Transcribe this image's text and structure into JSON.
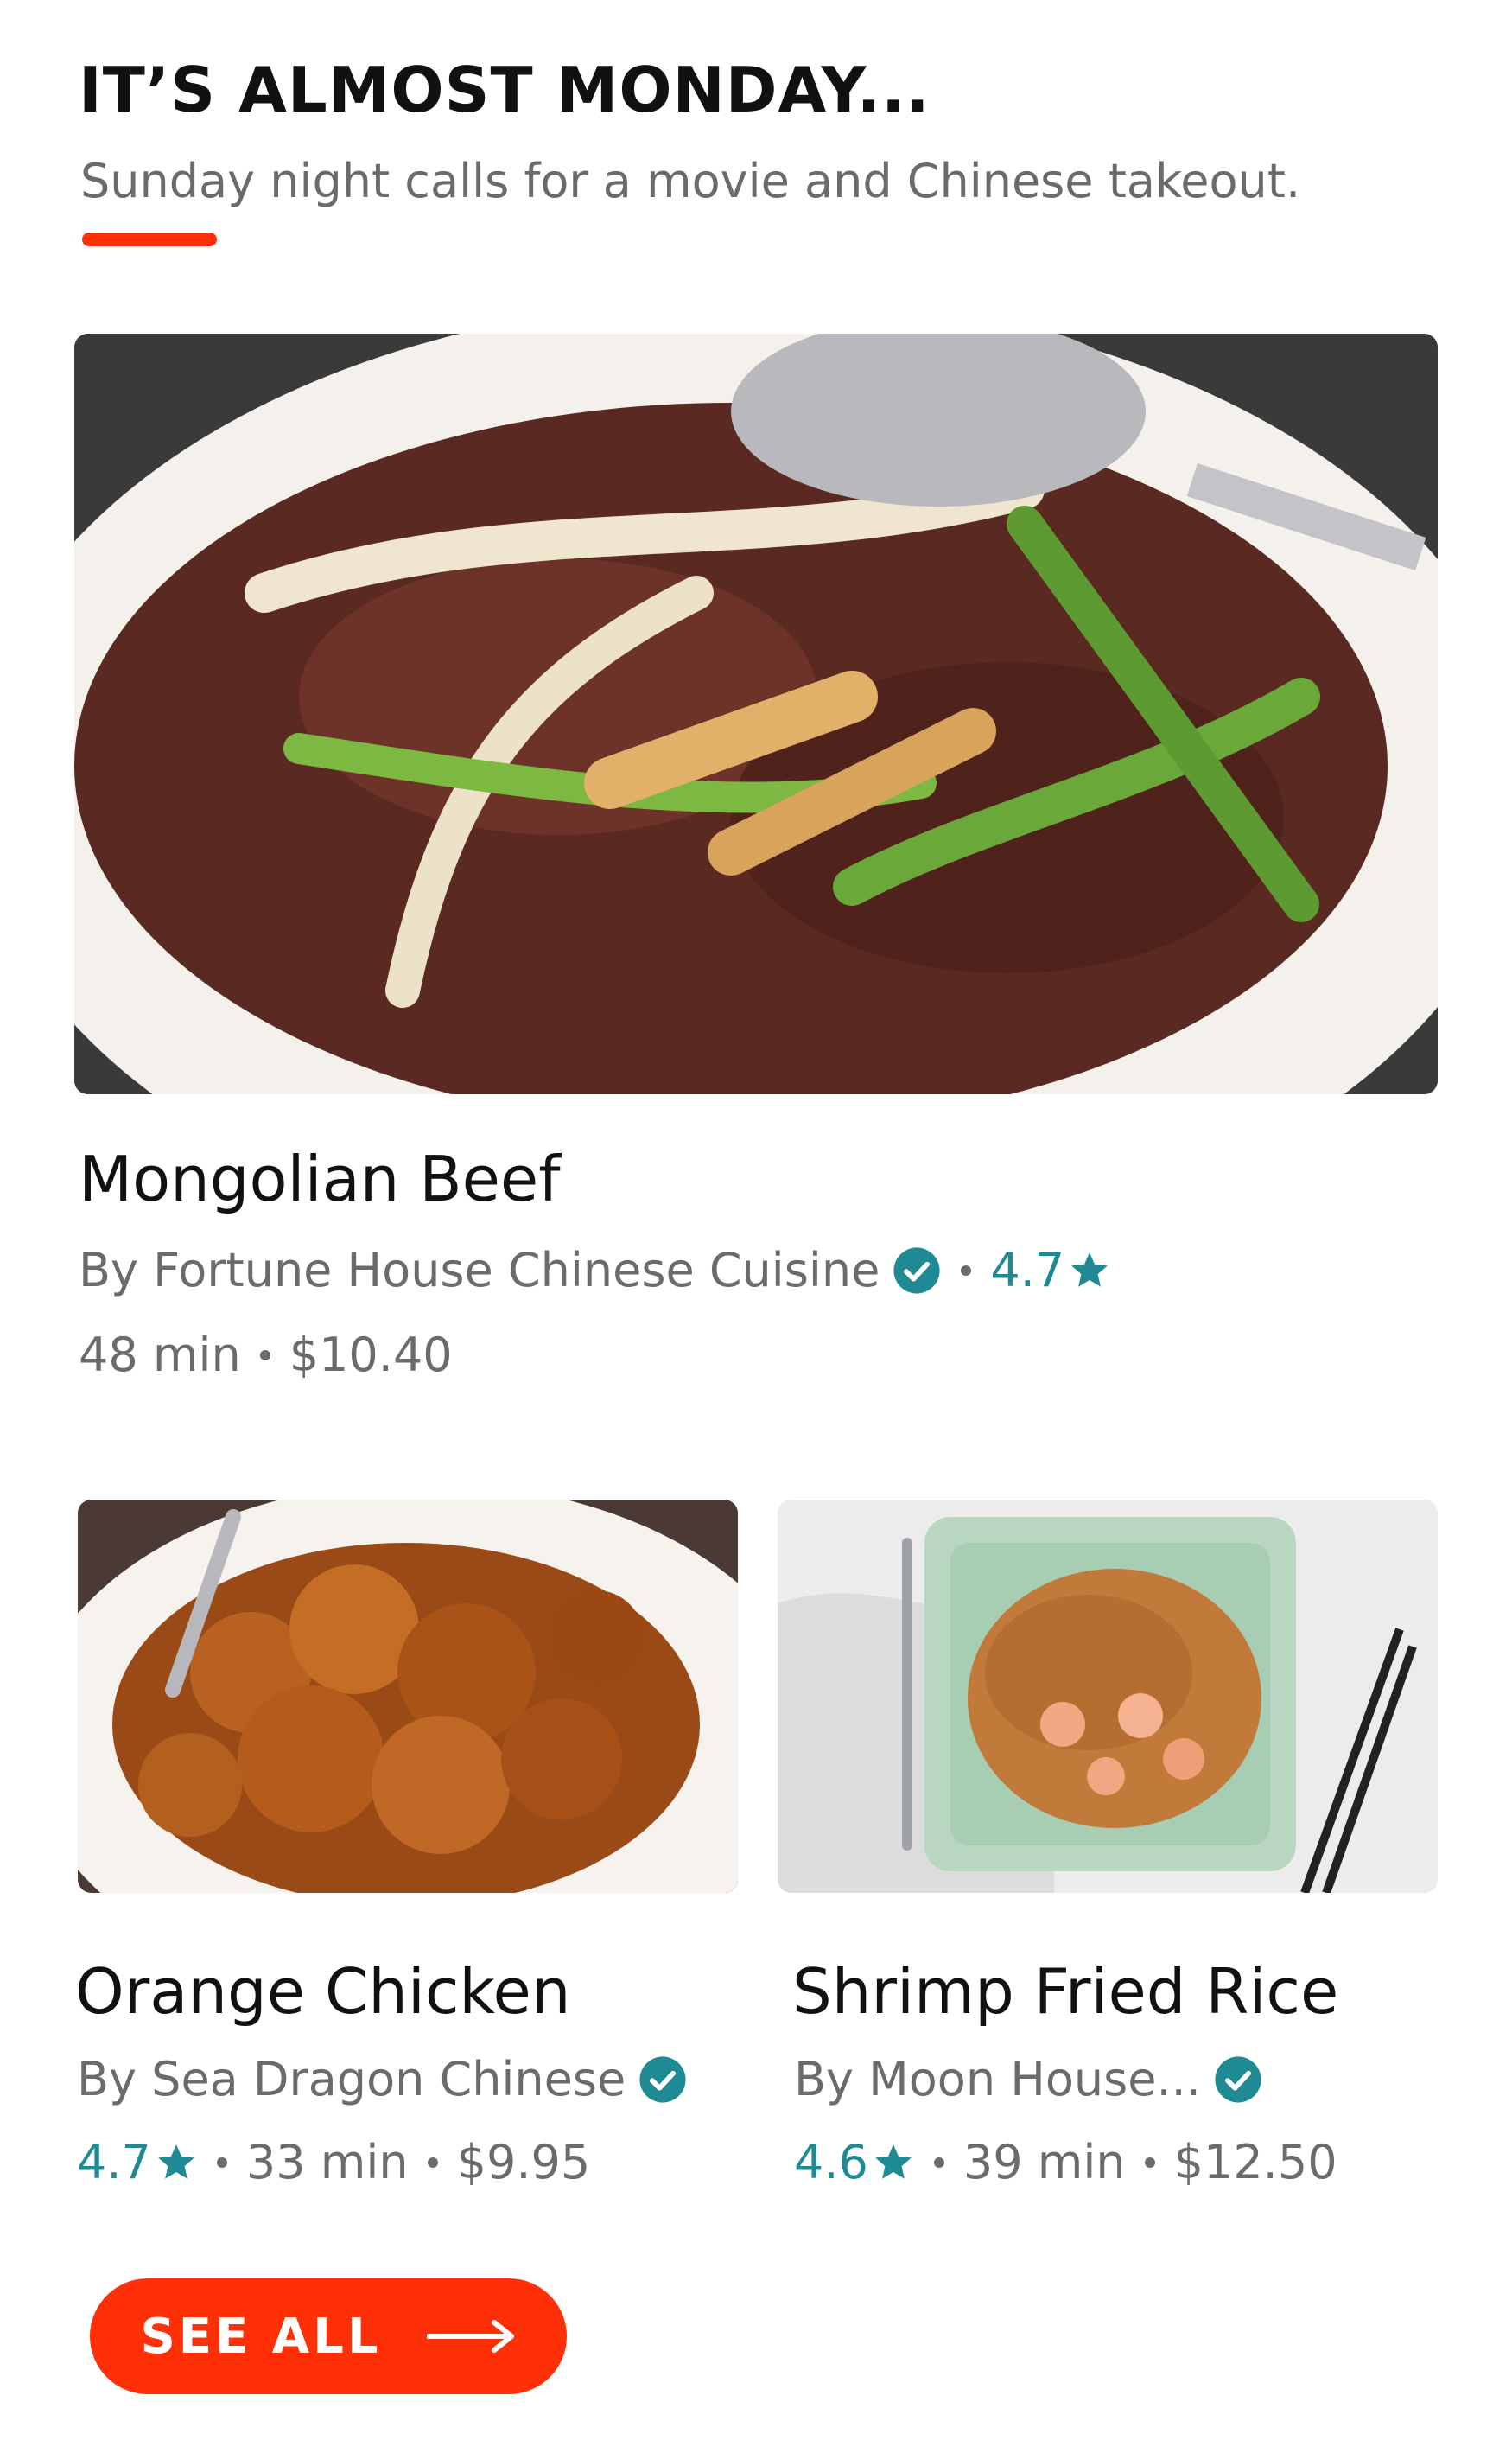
{
  "header": {
    "title": "IT’S ALMOST MONDAY...",
    "subtitle": "Sunday night calls for a movie and Chinese takeout."
  },
  "colors": {
    "accent": "#ff3008",
    "rating": "#1f8a93",
    "secondary_text": "#6b6b6b"
  },
  "featured": {
    "name": "Mongolian Beef",
    "store": "By Fortune House Chinese Cuisine",
    "verified_icon": "verified-check-icon",
    "rating": "4.7",
    "rating_icon": "star-icon",
    "time": "48 min",
    "price": "$10.40"
  },
  "items": [
    {
      "name": "Orange Chicken",
      "store": "By Sea Dragon Chinese",
      "rating": "4.7",
      "time": "33 min",
      "price": "$9.95"
    },
    {
      "name": "Shrimp Fried Rice",
      "store": "By Moon House...",
      "rating": "4.6",
      "time": "39 min",
      "price": "$12.50"
    }
  ],
  "cta": {
    "label": "SEE ALL",
    "icon": "arrow-right-icon"
  }
}
